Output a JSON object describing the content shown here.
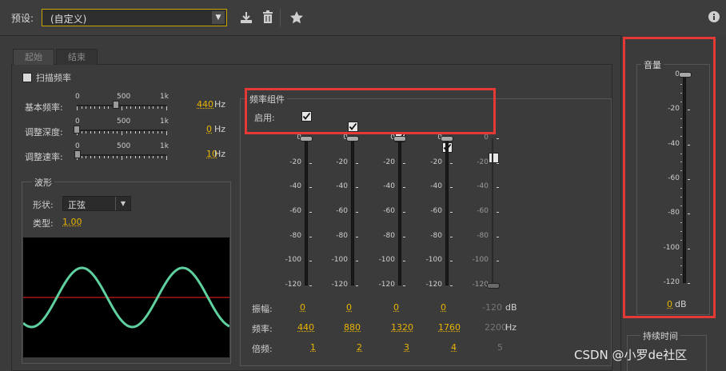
{
  "header": {
    "preset_label": "预设:",
    "preset_value": "(自定义)"
  },
  "tabs": [
    {
      "label": "起始"
    },
    {
      "label": "结束"
    }
  ],
  "sweep": {
    "label": "扫描频率"
  },
  "params": [
    {
      "label": "基本频率:",
      "value": "440",
      "unit": "Hz",
      "scale": [
        "0",
        "500",
        "1k"
      ],
      "level": 0.44
    },
    {
      "label": "调整深度:",
      "value": "0",
      "unit": "Hz",
      "scale": [
        "0",
        "500",
        "1k"
      ],
      "level": 0
    },
    {
      "label": "调整速率:",
      "value": "10",
      "unit": "Hz",
      "scale": [
        "0",
        "500",
        "1k"
      ],
      "level": 0.01
    }
  ],
  "waveform": {
    "legend": "波形",
    "shape_label": "形状:",
    "shape_value": "正弦",
    "type_label": "类型:",
    "type_value": "1.00"
  },
  "components": {
    "legend": "频率组件",
    "enable_label": "启用:",
    "enabled": [
      true,
      true,
      true,
      true,
      false
    ],
    "db_ticks": [
      "0",
      "-20",
      "-40",
      "-60",
      "-80",
      "-100",
      "-120"
    ],
    "amplitude_label": "振幅:",
    "amplitudes": [
      "0",
      "0",
      "0",
      "0",
      "-120"
    ],
    "amplitude_unit": "dB",
    "frequency_label": "频率:",
    "frequencies": [
      "440",
      "880",
      "1320",
      "1760",
      "2200"
    ],
    "frequency_unit": "Hz",
    "multiple_label": "倍频:",
    "multiples": [
      "1",
      "2",
      "3",
      "4",
      "5"
    ]
  },
  "volume": {
    "legend": "音量",
    "db_ticks": [
      "0",
      "-20",
      "-40",
      "-60",
      "-80",
      "-100",
      "-120"
    ],
    "value": "0",
    "unit": "dB"
  },
  "duration": {
    "legend": "持续时间"
  },
  "watermark": "CSDN @小罗de社区",
  "colors": {
    "accent": "#e8b400",
    "highlight_box": "#e53935",
    "wave": "#5fd0a0",
    "center_line": "#c81e1e"
  }
}
